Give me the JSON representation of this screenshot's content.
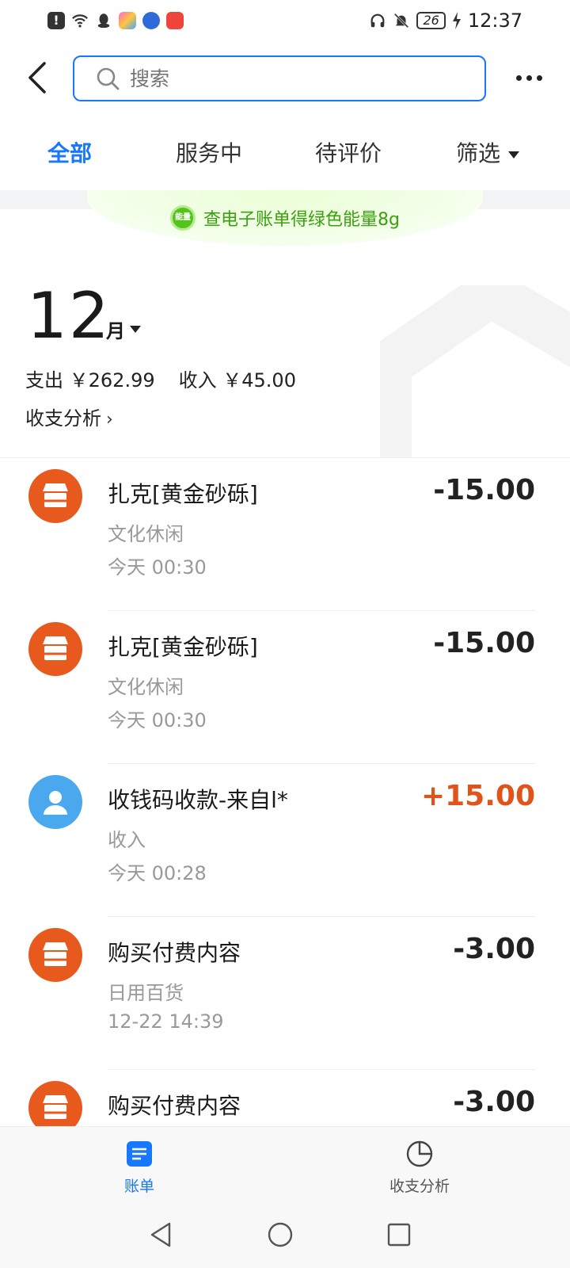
{
  "status_bar": {
    "battery": "26",
    "time": "12:37"
  },
  "search": {
    "placeholder": "搜索"
  },
  "tabs": [
    {
      "label": "全部",
      "active": true
    },
    {
      "label": "服务中",
      "active": false
    },
    {
      "label": "待评价",
      "active": false
    },
    {
      "label": "筛选",
      "active": false
    }
  ],
  "banner": {
    "badge": "能量",
    "text": "查电子账单得绿色能量8g"
  },
  "summary": {
    "month": "12",
    "month_unit": "月",
    "expense_label": "支出",
    "expense_value": "￥262.99",
    "income_label": "收入",
    "income_value": "￥45.00",
    "analysis_label": "收支分析"
  },
  "transactions": [
    {
      "icon": "shop-icon",
      "title": "扎克[黄金砂砾]",
      "category": "文化休闲",
      "time": "今天  00:30",
      "amount": "-15.00"
    },
    {
      "icon": "shop-icon",
      "title": "扎克[黄金砂砾]",
      "category": "文化休闲",
      "time": "今天  00:30",
      "amount": "-15.00"
    },
    {
      "icon": "person-icon",
      "title": "收钱码收款-来自l*",
      "category": "收入",
      "time": "今天  00:28",
      "amount": "+15.00"
    },
    {
      "icon": "shop-icon",
      "title": "购买付费内容",
      "category": "日用百货",
      "time": "12-22  14:39",
      "amount": "-3.00"
    },
    {
      "icon": "shop-icon",
      "title": "购买付费内容",
      "category": "",
      "time": "",
      "amount": "-3.00"
    }
  ],
  "bottom_tabs": [
    {
      "label": "账单",
      "active": true,
      "icon": "bill-icon"
    },
    {
      "label": "收支分析",
      "active": false,
      "icon": "pie-chart-icon"
    }
  ],
  "colors": {
    "accent": "#1677ff",
    "income": "#e0541a",
    "shop_icon_bg": "#e8591e",
    "person_icon_bg": "#4aa8ef",
    "energy_green": "#3aa10f"
  }
}
